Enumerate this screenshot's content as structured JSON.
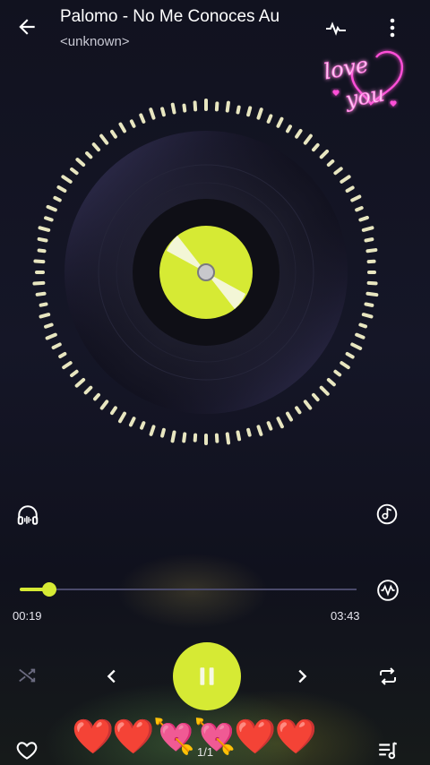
{
  "header": {
    "title": "Palomo - No Me Conoces Au",
    "artist": "<unknown>"
  },
  "overlay": {
    "love_line1": "love",
    "love_line2": "you"
  },
  "player": {
    "current_time": "00:19",
    "total_time": "03:43",
    "progress": 0.088,
    "page_indicator": "1/1",
    "hearts": "❤️❤️💘💘❤️❤️"
  },
  "colors": {
    "accent": "#d6ea34",
    "dots": "#e8e6c0",
    "track": "#4a4a6a"
  }
}
